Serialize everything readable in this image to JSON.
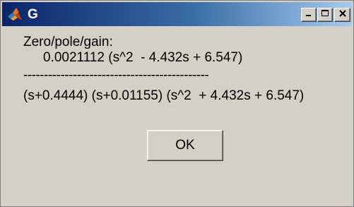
{
  "window": {
    "title": "G",
    "icon": "matlab-logo-icon",
    "controls": {
      "minimize_icon": "minimize-icon",
      "maximize_icon": "maximize-icon",
      "close_icon": "close-icon"
    }
  },
  "message": {
    "heading": "Zero/pole/gain:",
    "numerator": "0.0021112 (s^2  - 4.432s + 6.547)",
    "divider": "---------------------------------------------",
    "denominator": "(s+0.4444) (s+0.01155) (s^2  + 4.432s + 6.547)"
  },
  "buttons": {
    "ok_label": "OK"
  },
  "colors": {
    "face": "#d4d0c8",
    "title_gradient_start": "#0a246a",
    "title_gradient_end": "#a6caf0",
    "title_text": "#ffffff"
  }
}
